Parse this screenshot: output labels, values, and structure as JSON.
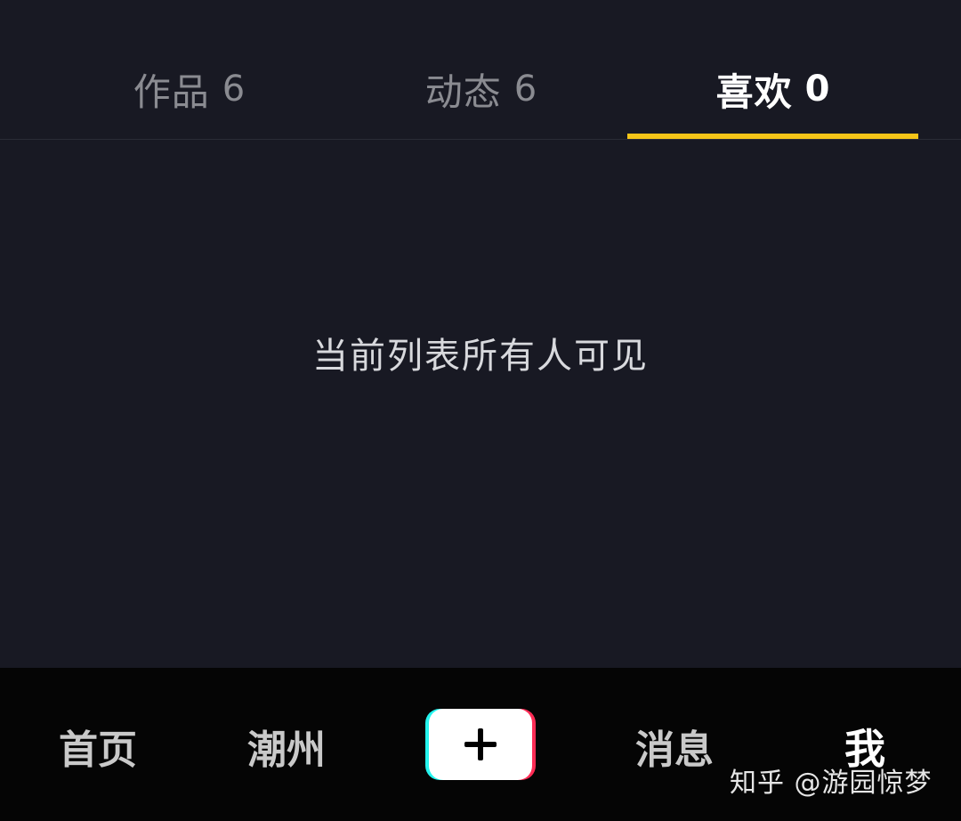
{
  "tabs": [
    {
      "label": "作品",
      "count": "6",
      "active": false
    },
    {
      "label": "动态",
      "count": "6",
      "active": false
    },
    {
      "label": "喜欢",
      "count": "0",
      "active": true
    }
  ],
  "content": {
    "empty_message": "当前列表所有人可见"
  },
  "bottom_nav": {
    "home": "首页",
    "city": "潮州",
    "messages": "消息",
    "me": "我"
  },
  "watermark": "知乎 @游园惊梦",
  "colors": {
    "background": "#181923",
    "bottom_bar": "#050505",
    "indicator": "#f5c518",
    "plus_cyan": "#25f4ee",
    "plus_red": "#fe2c55"
  },
  "icons": {
    "plus_button": "plus-icon"
  }
}
